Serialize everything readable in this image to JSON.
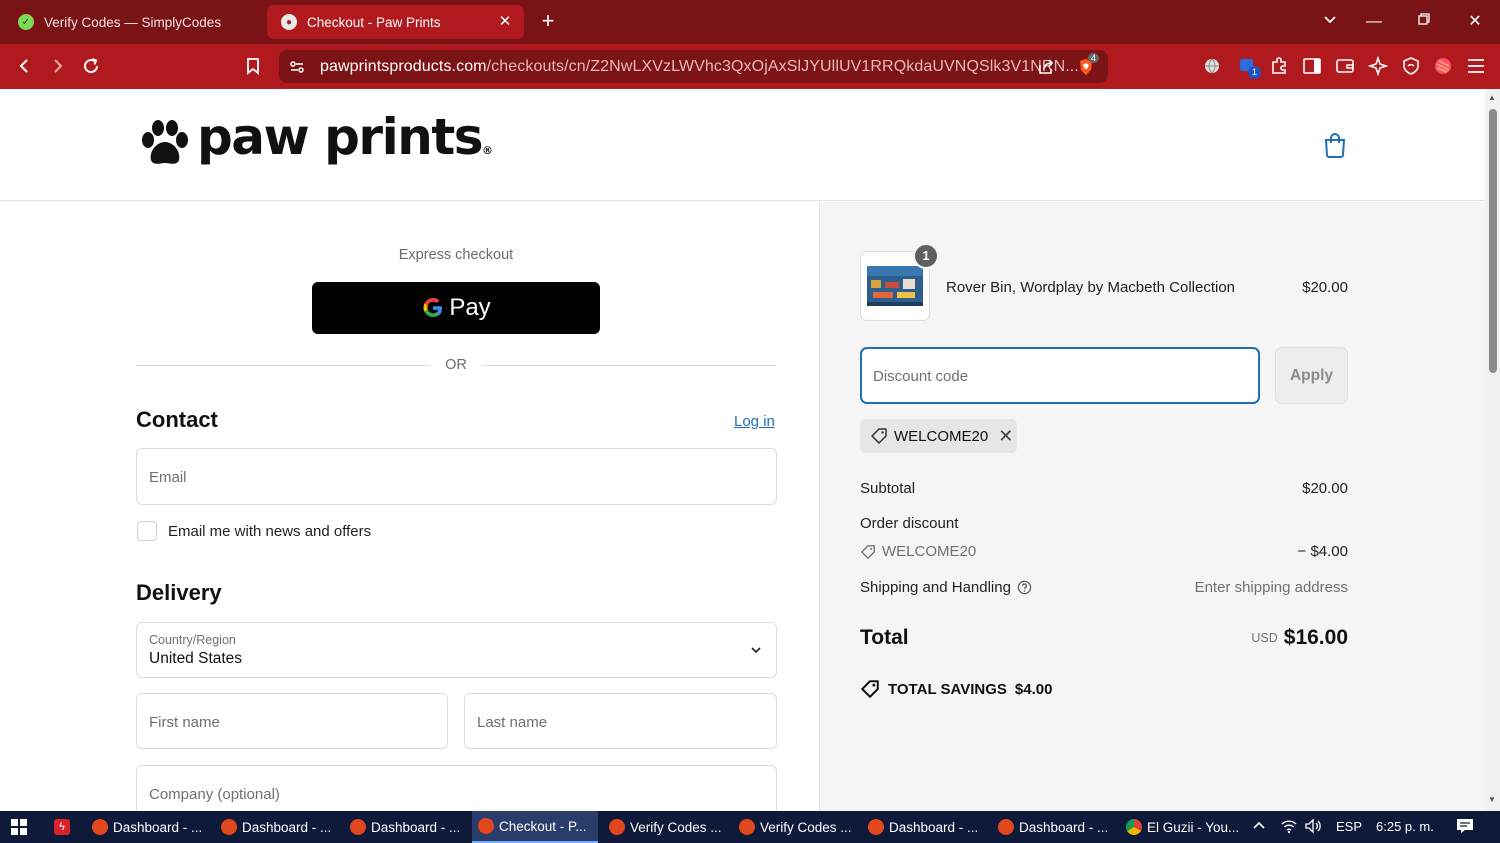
{
  "browser": {
    "tabs": [
      {
        "title": "Verify Codes — SimplyCodes",
        "active": false
      },
      {
        "title": "Checkout - Paw Prints",
        "active": true
      }
    ],
    "url_host": "pawprintsproducts.com",
    "url_path": "/checkouts/cn/Z2NwLXVzLWVhc3QxOjAxSlJYUllUV1RRQkdaUVNQSlk3V1NRN...",
    "brave_badge": "4",
    "ext_badge": "1",
    "colors": {
      "tabbar": "#7a1316",
      "navbar": "#b01a1e"
    }
  },
  "header": {
    "logo_text": "paw prints",
    "logo_mark": "®"
  },
  "checkout": {
    "express_label": "Express checkout",
    "gpay_label": "Pay",
    "gpay_g": "G",
    "or_label": "OR",
    "contact_title": "Contact",
    "login_label": "Log in",
    "email_placeholder": "Email",
    "news_label": "Email me with news and offers",
    "delivery_title": "Delivery",
    "country_label": "Country/Region",
    "country_value": "United States",
    "first_name_placeholder": "First name",
    "last_name_placeholder": "Last name",
    "company_placeholder": "Company (optional)"
  },
  "summary": {
    "item_qty": "1",
    "item_name": "Rover Bin, Wordplay by Macbeth Collection",
    "item_price": "$20.00",
    "discount_placeholder": "Discount code",
    "apply_label": "Apply",
    "applied_code": "WELCOME20",
    "subtotal_label": "Subtotal",
    "subtotal_value": "$20.00",
    "order_discount_label": "Order discount",
    "order_discount_code": "WELCOME20",
    "order_discount_value": "− $4.00",
    "shipping_label": "Shipping and Handling",
    "shipping_value": "Enter shipping address",
    "total_label": "Total",
    "total_currency": "USD",
    "total_value": "$16.00",
    "savings_label": "TOTAL SAVINGS",
    "savings_value": "$4.00",
    "accent_color": "#1f6fb5"
  },
  "taskbar": {
    "items": [
      {
        "label": "Dashboard - ...",
        "icon": "brave-icon"
      },
      {
        "label": "Dashboard - ...",
        "icon": "brave-icon"
      },
      {
        "label": "Dashboard - ...",
        "icon": "brave-icon"
      },
      {
        "label": "Checkout - P...",
        "icon": "brave-icon",
        "active": true
      },
      {
        "label": "Verify Codes ...",
        "icon": "brave-icon"
      },
      {
        "label": "Verify Codes ...",
        "icon": "brave-icon"
      },
      {
        "label": "Dashboard - ...",
        "icon": "brave-icon"
      },
      {
        "label": "Dashboard - ...",
        "icon": "brave-icon"
      },
      {
        "label": "El Guzii - You...",
        "icon": "chrome-icon"
      }
    ],
    "language": "ESP",
    "time": "6:25 p. m."
  }
}
